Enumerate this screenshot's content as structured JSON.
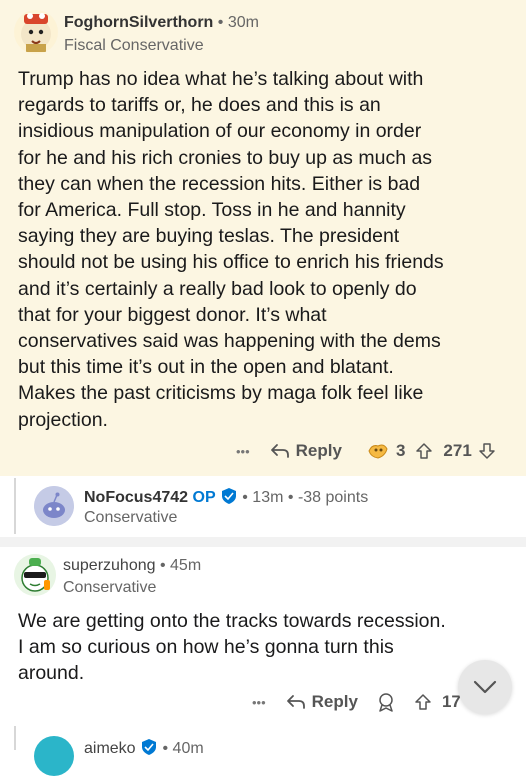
{
  "comments": [
    {
      "username": "FoghornSilverthorn",
      "time": "30m",
      "flair": "Fiscal Conservative",
      "lines": [
        "Trump has no idea what he’s talking about with",
        "regards to tariffs or, he does and this is an",
        "insidious manipulation of our economy in order",
        "for he and his rich cronies to buy up as much as",
        "they can when the recession hits.  Either is bad",
        "for America. Full stop. Toss in he and hannity",
        "saying they are buying teslas. The president",
        "should not be using his office to enrich his friends",
        "and it’s certainly a really bad look to openly do",
        "that for your biggest donor. It’s what",
        "conservatives said was happening with the dems",
        "but this time it’s out in the open and blatant.",
        "Makes the past criticisms by maga folk feel like",
        "projection."
      ],
      "more": "•••",
      "reply": "Reply",
      "awards": "3",
      "score": "271"
    },
    {
      "username": "NoFocus4742",
      "op_badge": "OP",
      "time": "13m",
      "points": "-38 points",
      "flair": "Conservative"
    },
    {
      "username": "superzuhong",
      "time": "45m",
      "flair": "Conservative",
      "lines": [
        "We are getting onto the tracks towards recession.",
        "I am so curious on how he’s gonna turn this",
        "around."
      ],
      "more": "•••",
      "reply": "Reply",
      "score": "17"
    },
    {
      "username": "aimeko",
      "time": "40m"
    }
  ],
  "separator": "•",
  "colors": {
    "highlight_bg": "#fcf6e2",
    "op_blue": "#0079d3",
    "award_gold": "#f5b942"
  }
}
